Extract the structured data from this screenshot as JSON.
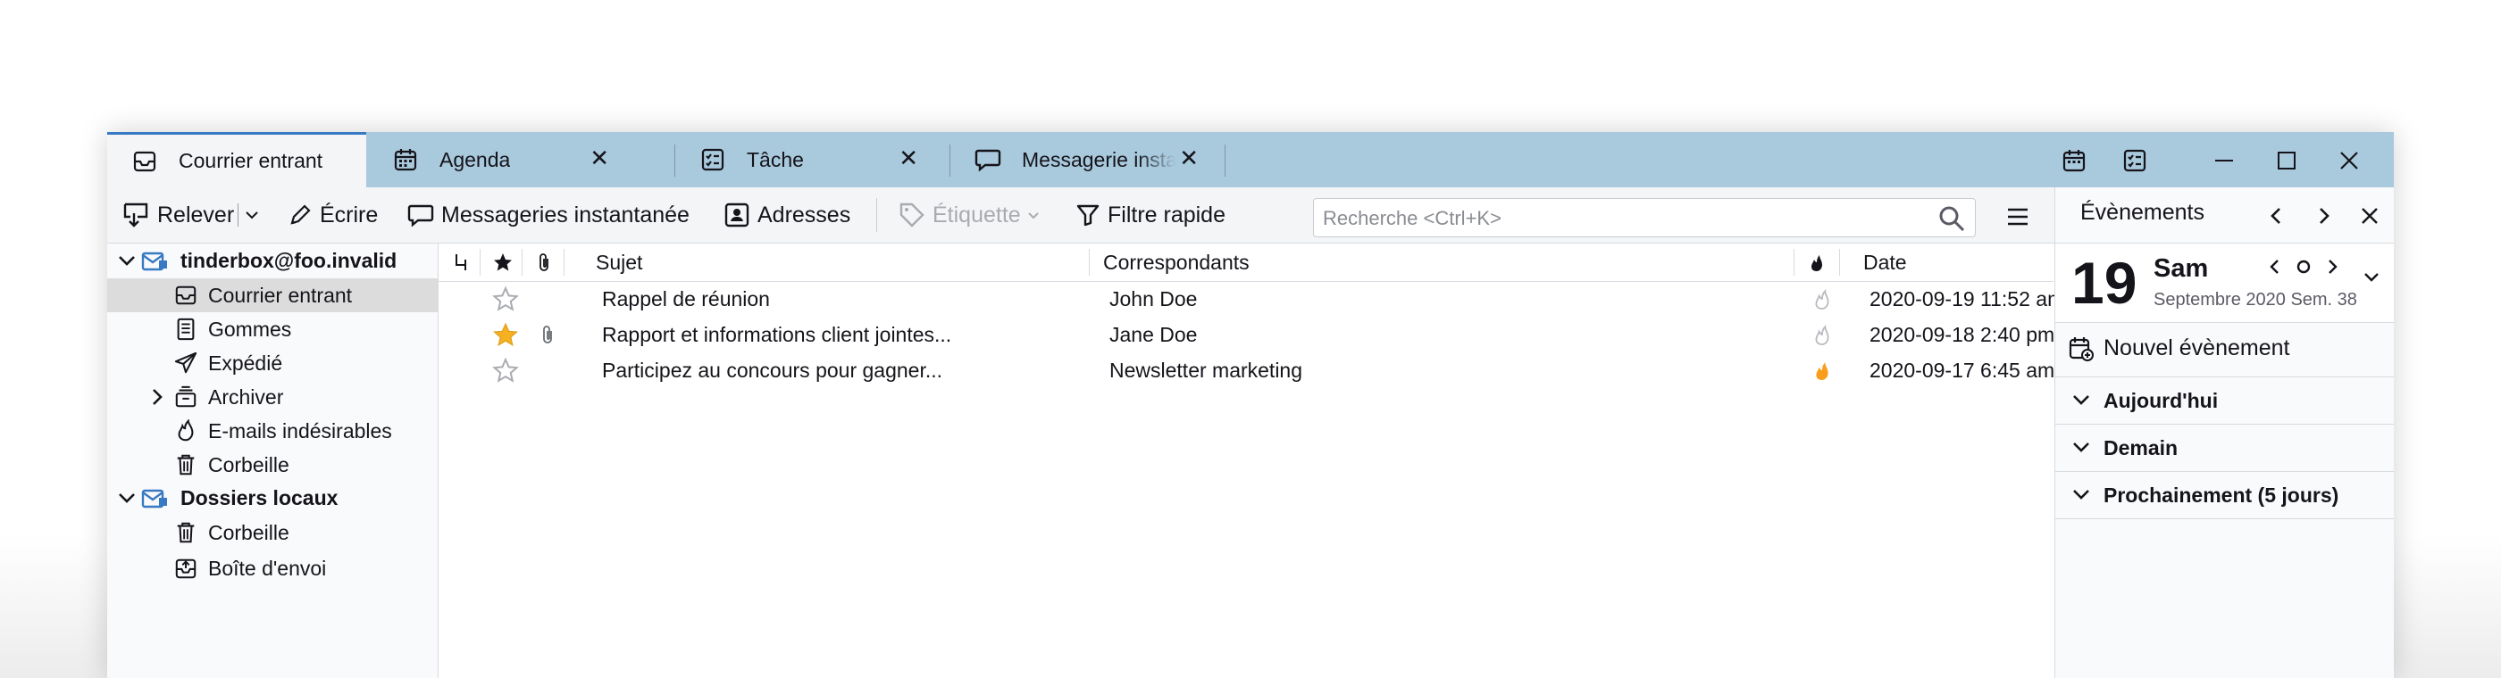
{
  "colors": {
    "tabbar": "#a9c9dd",
    "accent": "#3879c3",
    "star_active": "#f6b121",
    "junk_active": "#f99e1b",
    "selected_folder": "#dcdcdc"
  },
  "tabs": [
    {
      "label": "Courrier entrant",
      "icon": "inbox-icon",
      "active": true
    },
    {
      "label": "Agenda",
      "icon": "calendar-icon",
      "close": "✕"
    },
    {
      "label": "Tâche",
      "icon": "tasks-icon",
      "close": "✕"
    },
    {
      "label": "Messagerie insta",
      "icon": "chat-icon",
      "close": "✕"
    }
  ],
  "toolbar": {
    "get_messages": "Relever",
    "write": "Écrire",
    "chat": "Messageries instantanée",
    "address_book": "Adresses",
    "tag": "Étiquette",
    "quick_filter": "Filtre rapide",
    "search_placeholder": "Recherche <Ctrl+K>"
  },
  "folders": {
    "account1": "tinderbox@foo.invalid",
    "account1_folders": [
      "Courrier entrant",
      "Gommes",
      "Expédié",
      "Archiver",
      "E-mails indésirables",
      "Corbeille"
    ],
    "account2": "Dossiers locaux",
    "account2_folders": [
      "Corbeille",
      "Boîte d'envoi"
    ]
  },
  "thread_columns": {
    "subject": "Sujet",
    "correspondents": "Correspondants",
    "date": "Date"
  },
  "messages": [
    {
      "subject": "Rappel de réunion",
      "from": "John Doe",
      "date": "2020-09-19 11:52 am",
      "starred": false,
      "attachment": false,
      "junk": false
    },
    {
      "subject": "Rapport et informations client jointes...",
      "from": "Jane Doe",
      "date": "2020-09-18 2:40 pm",
      "starred": true,
      "attachment": true,
      "junk": false
    },
    {
      "subject": "Participez au concours pour gagner...",
      "from": "Newsletter marketing",
      "date": "2020-09-17 6:45 am",
      "starred": false,
      "attachment": false,
      "junk": true
    }
  ],
  "today_pane": {
    "title": "Évènements",
    "day_number": "19",
    "day_name": "Sam",
    "month_info": "Septembre 2020 Sem. 38",
    "new_event": "Nouvel évènement",
    "sections": [
      "Aujourd'hui",
      "Demain",
      "Prochainement (5 jours)"
    ]
  }
}
